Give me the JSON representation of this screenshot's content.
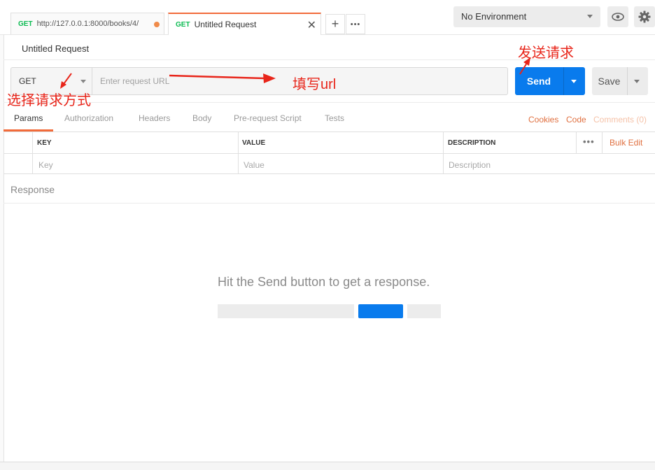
{
  "tabs": [
    {
      "method": "GET",
      "label": "http://127.0.0.1:8000/books/4/"
    },
    {
      "method": "GET",
      "label": "Untitled Request"
    }
  ],
  "tab_close": "✕",
  "new_tab": "+",
  "more_tabs": "•••",
  "environment": {
    "selected": "No Environment"
  },
  "request": {
    "title": "Untitled Request",
    "method": "GET",
    "url_placeholder": "Enter request URL",
    "send_label": "Send",
    "save_label": "Save"
  },
  "subtabs": [
    "Params",
    "Authorization",
    "Headers",
    "Body",
    "Pre-request Script",
    "Tests"
  ],
  "right_links": {
    "cookies": "Cookies",
    "code": "Code",
    "comments": "Comments (0)"
  },
  "params": {
    "headers": {
      "key": "KEY",
      "value": "VALUE",
      "description": "DESCRIPTION"
    },
    "more": "•••",
    "bulk_edit": "Bulk Edit",
    "placeholders": {
      "key": "Key",
      "value": "Value",
      "description": "Description"
    }
  },
  "response": {
    "label": "Response",
    "hint": "Hit the Send button to get a response."
  },
  "annotations": {
    "send_request": "发送请求",
    "fill_url": "填写url",
    "choose_method": "选择请求方式"
  },
  "colors": {
    "accent": "#f26b3a",
    "send_blue": "#097bed",
    "get_green": "#0cbb52",
    "annotation_red": "#e8251a"
  },
  "icons": {
    "eye": "eye-icon",
    "gear": "gear-icon",
    "caret": "chevron-down-icon"
  }
}
